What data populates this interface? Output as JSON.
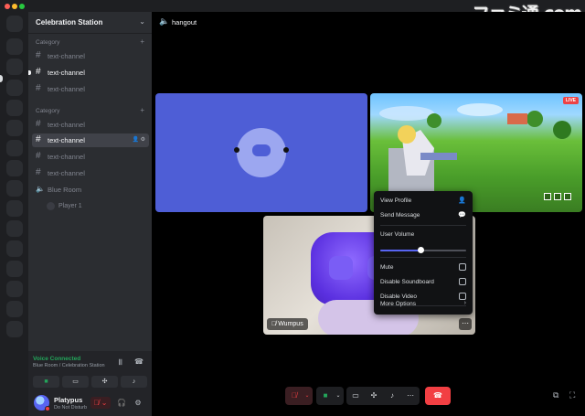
{
  "server": {
    "name": "Celebration Station"
  },
  "channels": {
    "category1": "Category",
    "category2": "Category",
    "list1": [
      "text-channel",
      "text-channel",
      "text-channel"
    ],
    "list2": [
      "text-channel",
      "text-channel",
      "text-channel",
      "text-channel"
    ],
    "voice_channel": "Blue Room",
    "voice_user": "Player 1"
  },
  "panel": {
    "voice_status": "Voice Connected",
    "voice_location": "Blue Room / Celebration Station",
    "user_name": "Platypus",
    "user_status": "Do Not Disturb"
  },
  "stage": {
    "title": "hangout",
    "game_live_badge": "LIVE",
    "cam_name_tag": "Wumpus"
  },
  "context_menu": {
    "view_profile": "View Profile",
    "send_message": "Send Message",
    "user_volume": "User Volume",
    "user_volume_level": 0.47,
    "mute": "Mute",
    "disable_soundboard": "Disable Soundboard",
    "disable_video": "Disable Video",
    "more_options": "More Options"
  },
  "icons": {
    "speaker": "speaker-icon",
    "hash": "hash-icon",
    "user": "user-icon",
    "chat": "chat-bubble-icon",
    "chevron": "chevron-right-icon",
    "mic_muted": "mic-muted-icon",
    "camera": "camera-icon",
    "screen": "screen-share-icon",
    "activities": "activities-icon",
    "soundboard": "soundboard-icon",
    "more": "more-icon",
    "hangup": "hang-up-icon",
    "popout": "popout-icon",
    "fullscreen": "fullscreen-icon",
    "headphones": "headphones-icon",
    "settings": "settings-gear-icon"
  },
  "colors": {
    "accent": "#5865f2",
    "online": "#23a55a",
    "danger": "#f23f43",
    "tile_blue": "#4e5ed6"
  },
  "watermark": "ファミ通.com"
}
